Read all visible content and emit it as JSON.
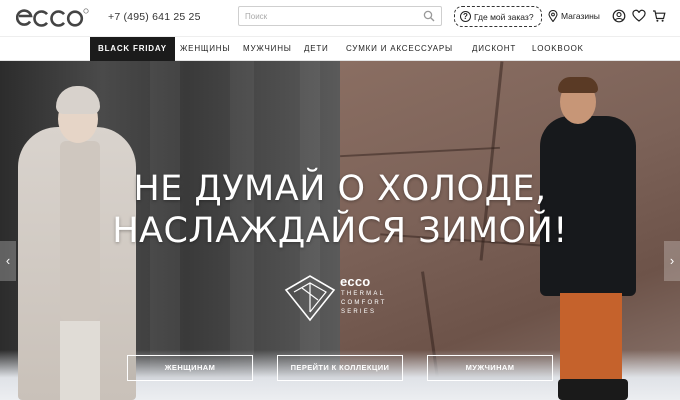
{
  "header": {
    "logo_text": "ecco",
    "phone": "+7 (495) 641 25 25",
    "search": {
      "placeholder": "Поиск",
      "value": ""
    },
    "order_label": "Где мой заказ?",
    "stores_label": "Магазины",
    "icons": [
      "account-icon",
      "heart-icon",
      "cart-icon"
    ]
  },
  "nav": {
    "items": [
      {
        "label": "BLACK FRIDAY",
        "active": true
      },
      {
        "label": "ЖЕНЩИНЫ"
      },
      {
        "label": "МУЖЧИНЫ"
      },
      {
        "label": "ДЕТИ"
      },
      {
        "label": "СУМКИ И АКСЕССУАРЫ"
      },
      {
        "label": "ДИСКОНТ"
      },
      {
        "label": "LOOKBOOK"
      }
    ]
  },
  "hero": {
    "headline_line1": "НЕ ДУМАЙ О ХОЛОДЕ,",
    "headline_line2": "НАСЛАЖДАЙСЯ ЗИМОЙ!",
    "series": {
      "brand": "ecco",
      "line1": "THERMAL",
      "line2": "COMFORT",
      "line3": "SERIES"
    },
    "buttons": {
      "women": "ЖЕНЩИНАМ",
      "collection": "ПЕРЕЙТИ К КОЛЛЕКЦИИ",
      "men": "МУЖЧИНАМ"
    },
    "arrows": {
      "prev": "‹",
      "next": "›"
    }
  },
  "colors": {
    "nav_active_bg": "#1b1b1b",
    "text": "#222222",
    "hero_text": "#ffffff"
  }
}
